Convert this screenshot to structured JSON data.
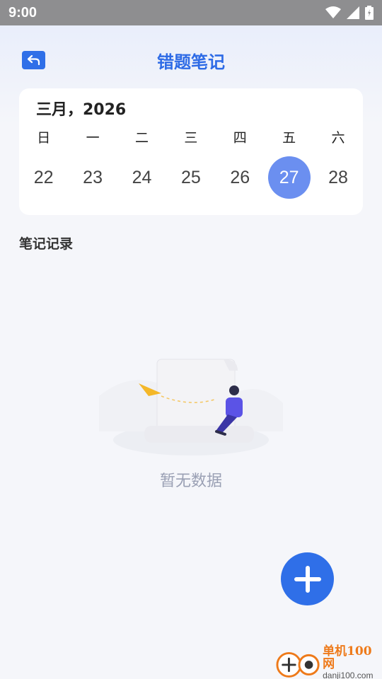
{
  "status_bar": {
    "time": "9:00"
  },
  "header": {
    "title": "错题笔记"
  },
  "calendar": {
    "month_label": "三月，2026",
    "weekdays": [
      "日",
      "一",
      "二",
      "三",
      "四",
      "五",
      "六"
    ],
    "dates": [
      "22",
      "23",
      "24",
      "25",
      "26",
      "27",
      "28"
    ],
    "selected_date": "27"
  },
  "notes": {
    "section_title": "笔记记录",
    "empty_text": "暂无数据"
  },
  "watermark": {
    "brand": "单机100网",
    "url": "danji100.com"
  },
  "colors": {
    "accent": "#2f6fe8",
    "selected_date": "#6b8ff0",
    "title": "#2e6be6"
  }
}
